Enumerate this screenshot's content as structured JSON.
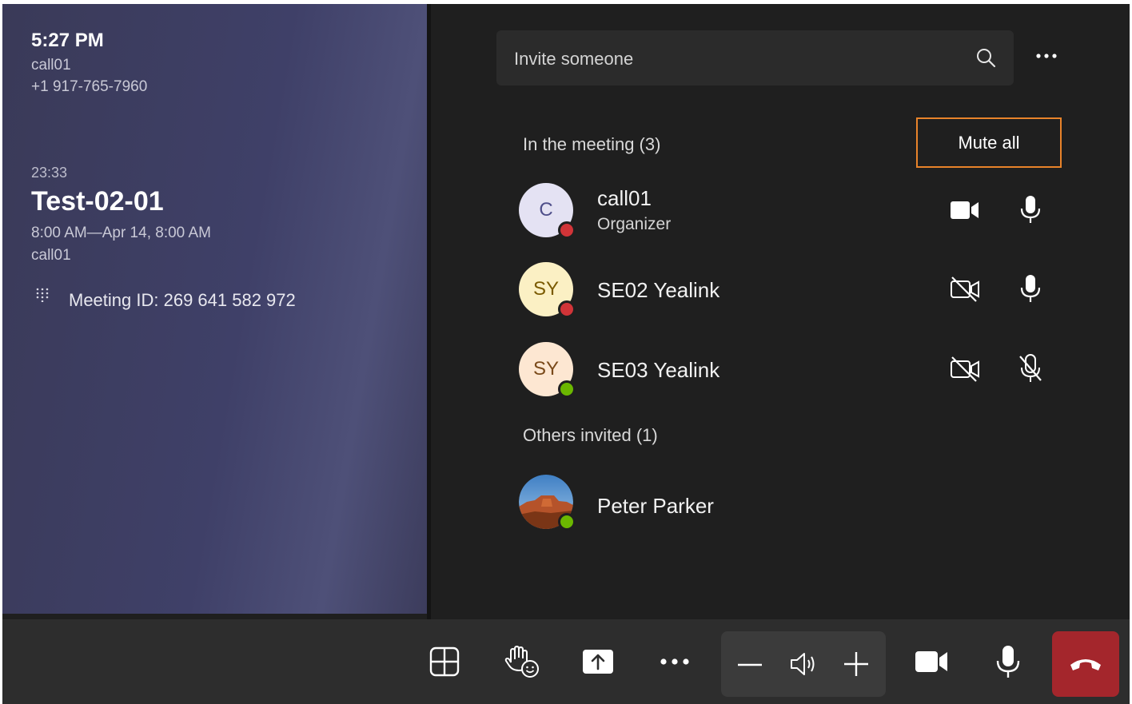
{
  "left_panel": {
    "clock": "5:27 PM",
    "caller_name": "call01",
    "caller_number": "+1 917-765-7960",
    "elapsed": "23:33",
    "meeting_title": "Test-02-01",
    "meeting_time": "8:00 AM—Apr 14, 8:00 AM",
    "meeting_host": "call01",
    "meeting_id": "Meeting ID:  269 641 582 972"
  },
  "search": {
    "placeholder": "Invite someone"
  },
  "in_meeting": {
    "title": "In the meeting (3)",
    "mute_all_label": "Mute all",
    "participants": [
      {
        "initials": "C",
        "name": "call01",
        "role": "Organizer",
        "status": "red",
        "camera": "on",
        "mic": "on",
        "avatar_bg": "#e4e2f3",
        "avatar_fg": "#4f4f8a"
      },
      {
        "initials": "SY",
        "name": "SE02 Yealink",
        "status": "red",
        "camera": "off",
        "mic": "on",
        "avatar_bg": "#fbf0c4",
        "avatar_fg": "#7a5a00"
      },
      {
        "initials": "SY",
        "name": "SE03 Yealink",
        "status": "green",
        "camera": "off",
        "mic": "off",
        "avatar_bg": "#fde7d2",
        "avatar_fg": "#7a4a1a"
      }
    ]
  },
  "others_invited": {
    "title": "Others invited (1)",
    "participants": [
      {
        "name": "Peter Parker",
        "status": "green",
        "avatar": "desert-photo"
      }
    ]
  },
  "toolbar": {
    "icons": [
      "layout-icon",
      "raise-hand-icon",
      "share-icon",
      "more-icon",
      "volume-down-icon",
      "speaker-icon",
      "volume-up-icon",
      "camera-icon",
      "mic-icon",
      "end-call-icon"
    ]
  },
  "colors": {
    "accent_focus": "#e8832a",
    "end_call": "#a4262c",
    "status_busy": "#d13438",
    "status_available": "#6bb700"
  }
}
